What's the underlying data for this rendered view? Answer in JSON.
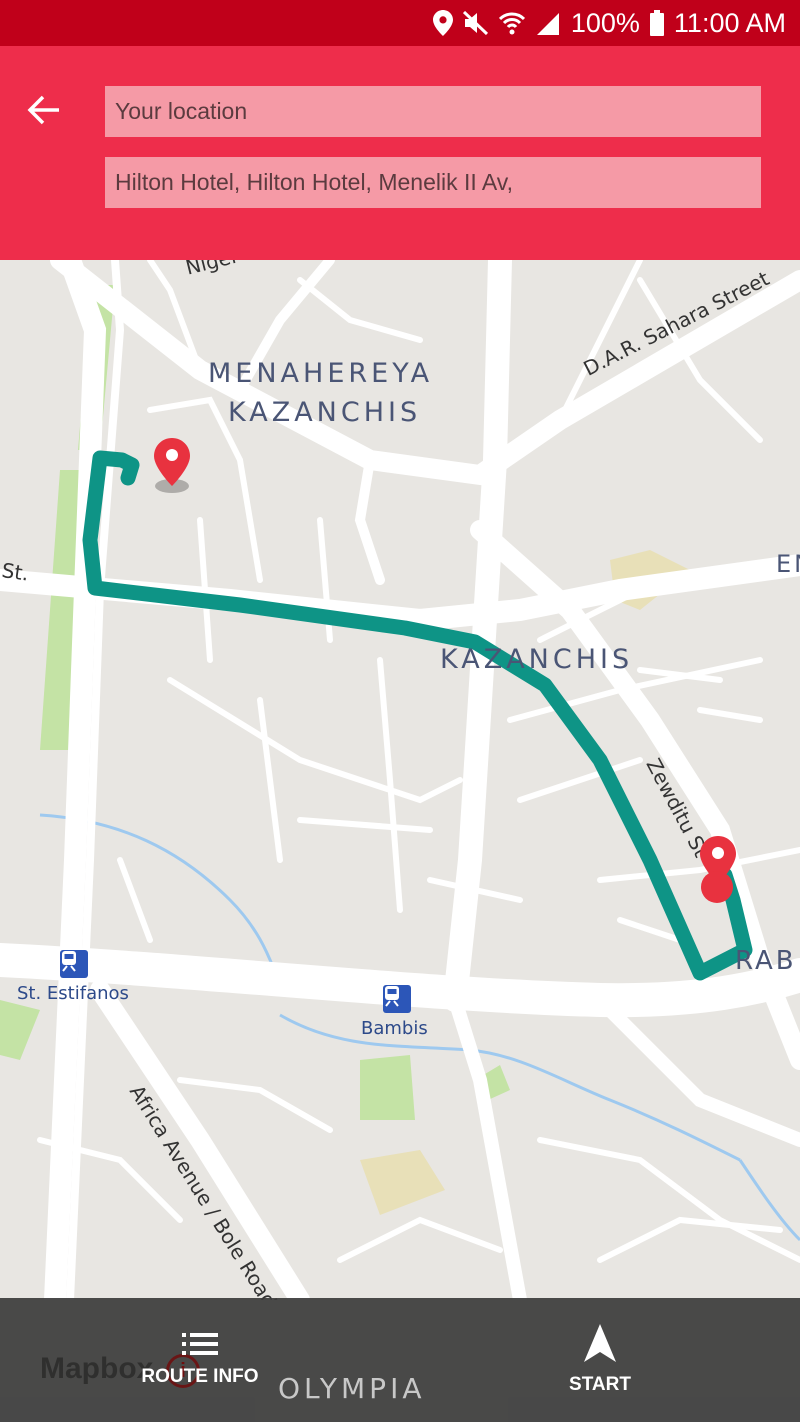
{
  "status_bar": {
    "battery": "100%",
    "time": "11:00 AM",
    "icons": [
      "location-icon",
      "mute-icon",
      "wifi-icon",
      "signal-icon",
      "battery-icon"
    ]
  },
  "header": {
    "back_icon": "arrow-left-icon",
    "origin": {
      "value": "Your location"
    },
    "destination": {
      "value": "Hilton Hotel, Hilton Hotel, Menelik II Av,"
    }
  },
  "map": {
    "areas": [
      "MENAHEREYA",
      "KAZANCHIS",
      "KAZANCHIS"
    ],
    "streets": {
      "niger": "Niger",
      "dar_sahara": "D.A.R. Sahara Street",
      "zewditu": "Zewditu St",
      "st": "St.",
      "africa_avenue": "Africa Avenue / Bole Road",
      "en": "EN",
      "rab": "RAB"
    },
    "stations": [
      "St. Estifanos",
      "Bambis"
    ],
    "route_color": "#0e9486",
    "marker_color": "#e8323f"
  },
  "bottom_bar": {
    "route_info_label": "ROUTE INFO",
    "start_label": "START",
    "mapbox": "Mapbox",
    "olympia": "OLYMPIA"
  }
}
